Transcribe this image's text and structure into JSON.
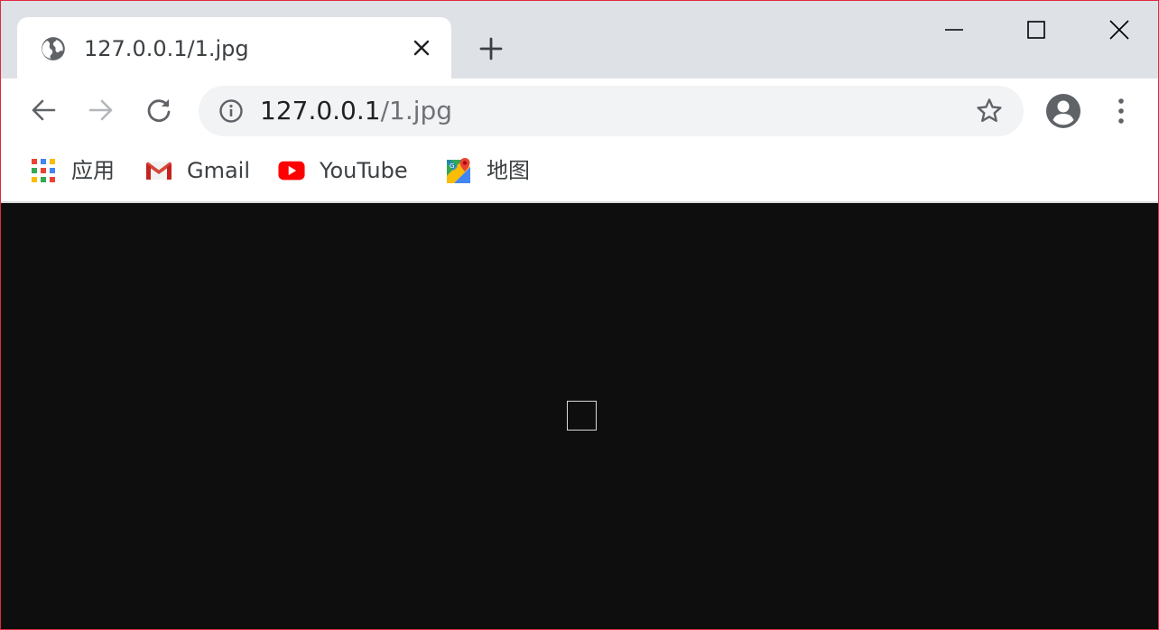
{
  "tab": {
    "title": "127.0.0.1/1.jpg",
    "favicon": "globe-icon"
  },
  "address_bar": {
    "url_host": "127.0.0.1",
    "url_path": "/1.jpg"
  },
  "bookmarks": [
    {
      "label": "应用",
      "icon": "apps-grid-icon"
    },
    {
      "label": "Gmail",
      "icon": "gmail-icon"
    },
    {
      "label": "YouTube",
      "icon": "youtube-icon"
    },
    {
      "label": "地图",
      "icon": "maps-icon"
    }
  ],
  "colors": {
    "tab_strip_bg": "#dee1e6",
    "omnibox_bg": "#f1f3f4",
    "content_bg": "#0e0e0e",
    "window_border": "#e0293f"
  }
}
